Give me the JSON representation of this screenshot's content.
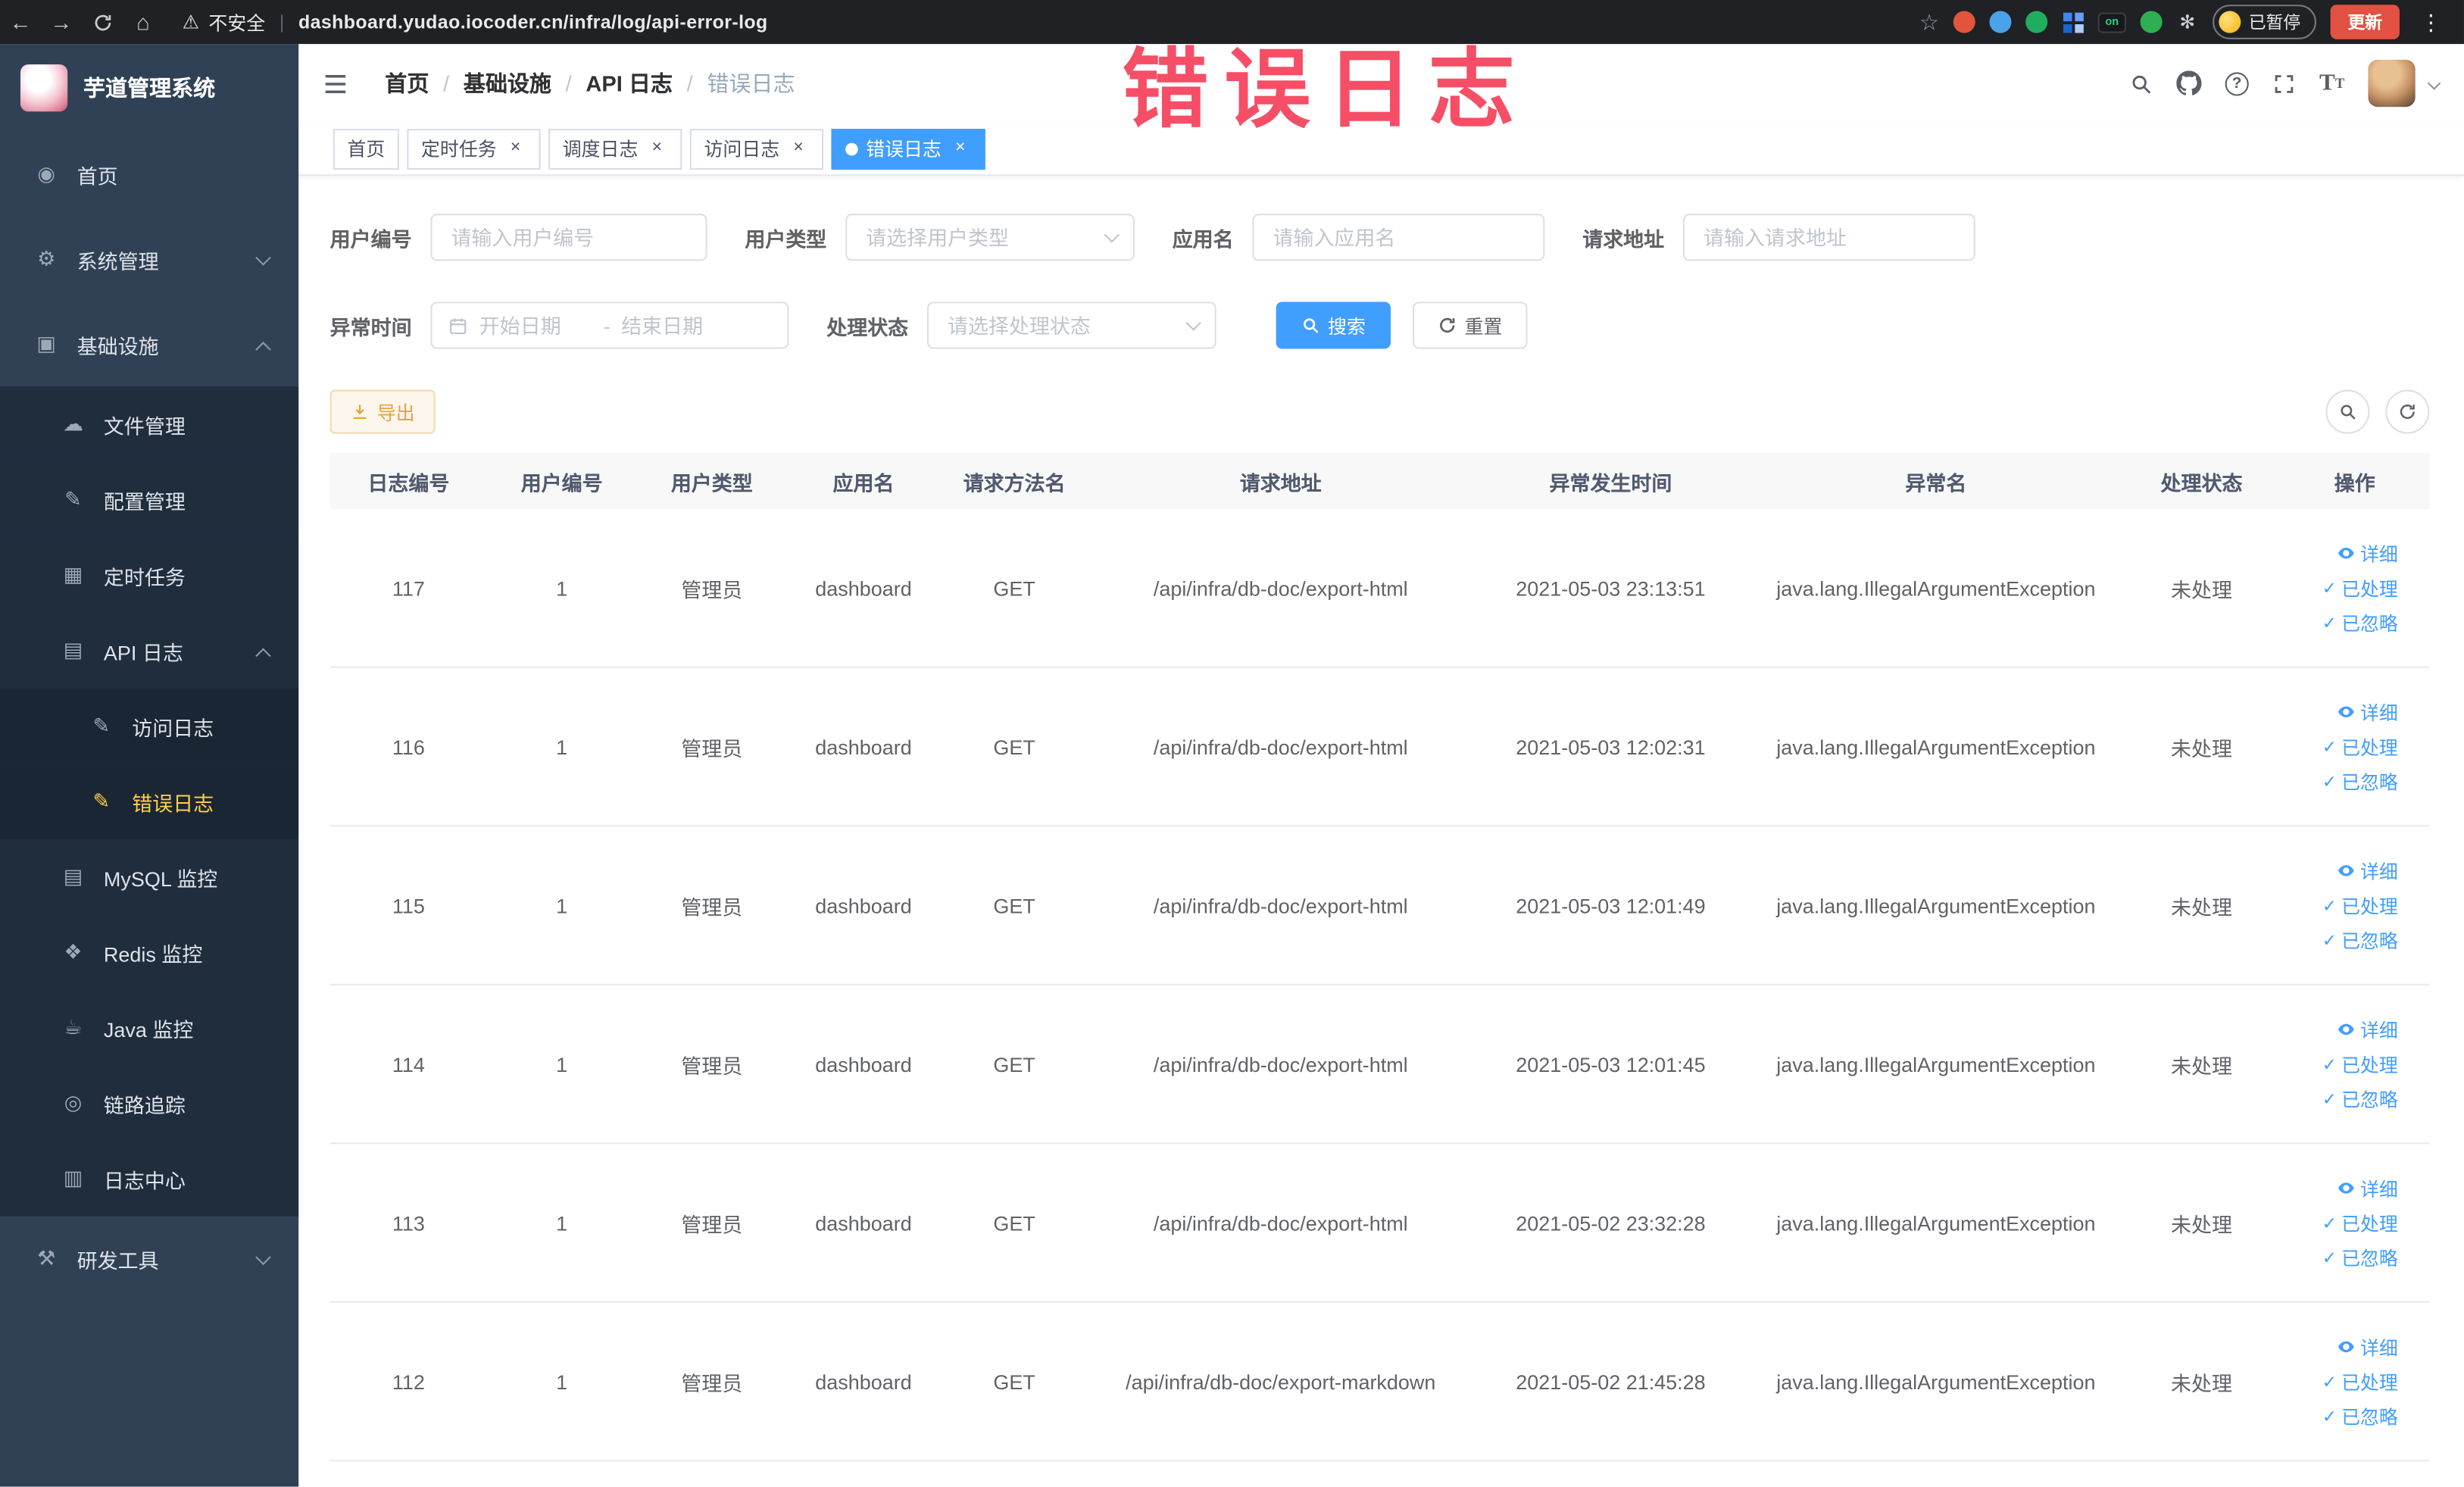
{
  "browser": {
    "security_label": "不安全",
    "url": "dashboard.yudao.iocoder.cn/infra/log/api-error-log",
    "paused_badge": "已暂停",
    "update_button": "更新",
    "extensions": [
      {
        "name": "record-dot-icon",
        "color": "#e2543b",
        "shape": "circle"
      },
      {
        "name": "water-drop-icon",
        "color": "#4aa3e8",
        "shape": "circle"
      },
      {
        "name": "devtools-icon",
        "color": "#1fae5e",
        "shape": "circle"
      },
      {
        "name": "apps-grid-icon",
        "color": "#4285f4",
        "shape": "grid"
      },
      {
        "name": "switch-on-icon",
        "color": "#17191c",
        "shape": "badge",
        "badge": "on"
      },
      {
        "name": "tree-icon",
        "color": "#2fae54",
        "shape": "circle"
      },
      {
        "name": "paw-icon",
        "color": "#caccd0",
        "shape": "glyph",
        "glyph": "✻"
      }
    ]
  },
  "watermark": "错误日志",
  "colors": {
    "primary": "#409eff",
    "warning": "#e6a23c",
    "sidebar_bg": "#304156",
    "sidebar_submenu_bg": "#1f2d3d",
    "active_menu_text": "#ffd04b",
    "watermark_red": "#f5455e",
    "active_tab_bg": "#409eff"
  },
  "sidebar": {
    "logo_title": "芋道管理系统",
    "items": [
      {
        "name": "home",
        "label": "首页",
        "icon": "dashboard-icon",
        "level": 1
      },
      {
        "name": "system",
        "label": "系统管理",
        "icon": "gear-icon",
        "level": 1,
        "chevron": "down"
      },
      {
        "name": "infrastructure",
        "label": "基础设施",
        "icon": "infra-icon",
        "level": 1,
        "chevron": "up"
      },
      {
        "name": "file-manage",
        "label": "文件管理",
        "icon": "cloud-icon",
        "level": 2
      },
      {
        "name": "config-manage",
        "label": "配置管理",
        "icon": "edit-icon",
        "level": 2
      },
      {
        "name": "scheduled-job",
        "label": "定时任务",
        "icon": "task-icon",
        "level": 2
      },
      {
        "name": "api-log",
        "label": "API 日志",
        "icon": "log-icon",
        "level": 2,
        "chevron": "up"
      },
      {
        "name": "api-access-log",
        "label": "访问日志",
        "icon": "doc-icon",
        "level": 3
      },
      {
        "name": "api-error-log",
        "label": "错误日志",
        "icon": "doc-icon",
        "level": 3,
        "active": true
      },
      {
        "name": "mysql-monitor",
        "label": "MySQL 监控",
        "icon": "database-icon",
        "level": 2
      },
      {
        "name": "redis-monitor",
        "label": "Redis 监控",
        "icon": "redis-icon",
        "level": 2
      },
      {
        "name": "java-monitor",
        "label": "Java 监控",
        "icon": "java-icon",
        "level": 2
      },
      {
        "name": "trace",
        "label": "链路追踪",
        "icon": "trace-icon",
        "level": 2
      },
      {
        "name": "log-center",
        "label": "日志中心",
        "icon": "log-center-icon",
        "level": 2
      },
      {
        "name": "dev-tools",
        "label": "研发工具",
        "icon": "tools-icon",
        "level": 1,
        "chevron": "down"
      }
    ]
  },
  "header": {
    "breadcrumb": [
      "首页",
      "基础设施",
      "API 日志",
      "错误日志"
    ]
  },
  "tabs": [
    {
      "name": "home",
      "label": "首页",
      "closable": false,
      "active": false
    },
    {
      "name": "job",
      "label": "定时任务",
      "closable": true,
      "active": false
    },
    {
      "name": "job-log",
      "label": "调度日志",
      "closable": true,
      "active": false
    },
    {
      "name": "api-access-log",
      "label": "访问日志",
      "closable": true,
      "active": false
    },
    {
      "name": "api-error-log",
      "label": "错误日志",
      "closable": true,
      "active": true
    }
  ],
  "filters": {
    "user_id": {
      "label": "用户编号",
      "placeholder": "请输入用户编号"
    },
    "user_type": {
      "label": "用户类型",
      "placeholder": "请选择用户类型"
    },
    "app_name": {
      "label": "应用名",
      "placeholder": "请输入应用名"
    },
    "request_url": {
      "label": "请求地址",
      "placeholder": "请输入请求地址"
    },
    "exception_time": {
      "label": "异常时间",
      "start_placeholder": "开始日期",
      "end_placeholder": "结束日期",
      "separator": "-"
    },
    "process_status": {
      "label": "处理状态",
      "placeholder": "请选择处理状态"
    },
    "search_button": "搜索",
    "reset_button": "重置"
  },
  "toolbar": {
    "export_button": "导出"
  },
  "table": {
    "headers": [
      "日志编号",
      "用户编号",
      "用户类型",
      "应用名",
      "请求方法名",
      "请求地址",
      "异常发生时间",
      "异常名",
      "处理状态",
      "操作"
    ],
    "actions": [
      "详细",
      "已处理",
      "已忽略"
    ],
    "rows": [
      {
        "id": "117",
        "user_id": "1",
        "user_type": "管理员",
        "app": "dashboard",
        "method": "GET",
        "url": "/api/infra/db-doc/export-html",
        "time": "2021-05-03 23:13:51",
        "exception": "java.lang.IllegalArgumentException",
        "status": "未处理"
      },
      {
        "id": "116",
        "user_id": "1",
        "user_type": "管理员",
        "app": "dashboard",
        "method": "GET",
        "url": "/api/infra/db-doc/export-html",
        "time": "2021-05-03 12:02:31",
        "exception": "java.lang.IllegalArgumentException",
        "status": "未处理"
      },
      {
        "id": "115",
        "user_id": "1",
        "user_type": "管理员",
        "app": "dashboard",
        "method": "GET",
        "url": "/api/infra/db-doc/export-html",
        "time": "2021-05-03 12:01:49",
        "exception": "java.lang.IllegalArgumentException",
        "status": "未处理"
      },
      {
        "id": "114",
        "user_id": "1",
        "user_type": "管理员",
        "app": "dashboard",
        "method": "GET",
        "url": "/api/infra/db-doc/export-html",
        "time": "2021-05-03 12:01:45",
        "exception": "java.lang.IllegalArgumentException",
        "status": "未处理"
      },
      {
        "id": "113",
        "user_id": "1",
        "user_type": "管理员",
        "app": "dashboard",
        "method": "GET",
        "url": "/api/infra/db-doc/export-html",
        "time": "2021-05-02 23:32:28",
        "exception": "java.lang.IllegalArgumentException",
        "status": "未处理"
      },
      {
        "id": "112",
        "user_id": "1",
        "user_type": "管理员",
        "app": "dashboard",
        "method": "GET",
        "url": "/api/infra/db-doc/export-markdown",
        "time": "2021-05-02 21:45:28",
        "exception": "java.lang.IllegalArgumentException",
        "status": "未处理"
      }
    ]
  }
}
